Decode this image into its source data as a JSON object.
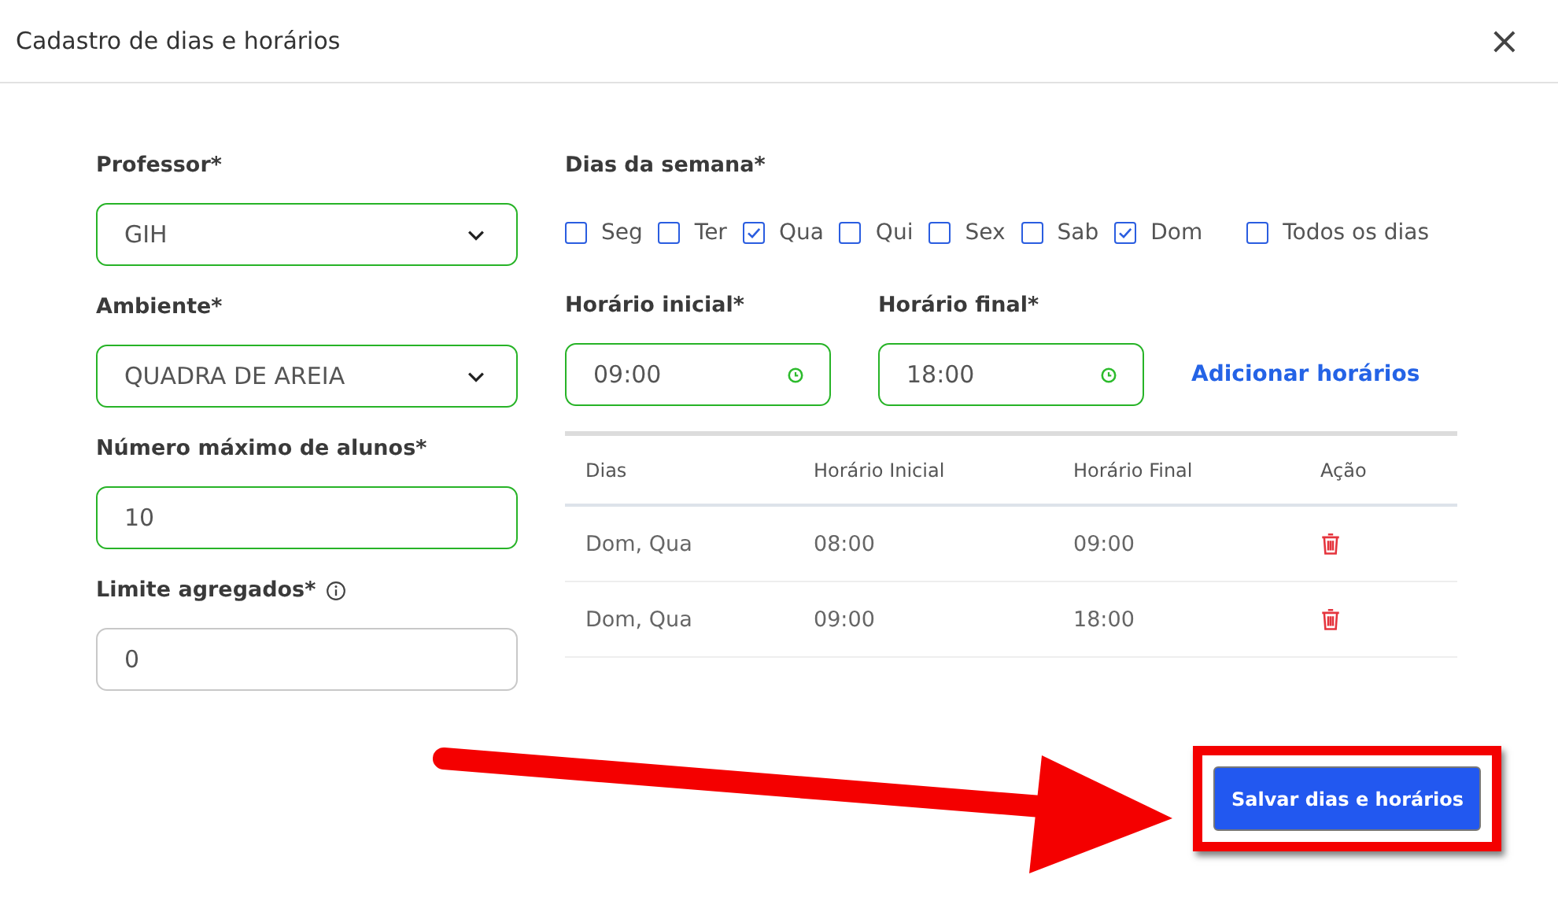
{
  "dialog": {
    "title": "Cadastro de dias e horários",
    "close": "×"
  },
  "fields": [
    {
      "label": "Professor*",
      "kind": "select",
      "value": "GIH",
      "valid": true,
      "info": false
    },
    {
      "label": "Ambiente*",
      "kind": "select",
      "value": "QUADRA DE AREIA",
      "valid": true,
      "info": false
    },
    {
      "label": "Número máximo de alunos*",
      "kind": "input",
      "value": "10",
      "valid": true,
      "info": false
    },
    {
      "label": "Limite agregados*",
      "kind": "input",
      "value": "0",
      "valid": false,
      "info": true
    }
  ],
  "weekdays": {
    "label": "Dias da semana*",
    "days": [
      {
        "label": "Seg",
        "checked": false
      },
      {
        "label": "Ter",
        "checked": false
      },
      {
        "label": "Qua",
        "checked": true
      },
      {
        "label": "Qui",
        "checked": false
      },
      {
        "label": "Sex",
        "checked": false
      },
      {
        "label": "Sab",
        "checked": false
      },
      {
        "label": "Dom",
        "checked": true
      }
    ],
    "all_days": {
      "label": "Todos os dias",
      "checked": false
    }
  },
  "times": [
    {
      "label": "Horário inicial*",
      "value": "09:00"
    },
    {
      "label": "Horário final*",
      "value": "18:00"
    }
  ],
  "add_link": "Adicionar horários",
  "table": {
    "columns": [
      "Dias",
      "Horário Inicial",
      "Horário Final",
      "Ação"
    ],
    "rows": [
      {
        "days": "Dom, Qua",
        "start": "08:00",
        "end": "09:00"
      },
      {
        "days": "Dom, Qua",
        "start": "09:00",
        "end": "18:00"
      }
    ]
  },
  "save_button": "Salvar dias e horários",
  "annotation": {
    "highlighted": true
  }
}
